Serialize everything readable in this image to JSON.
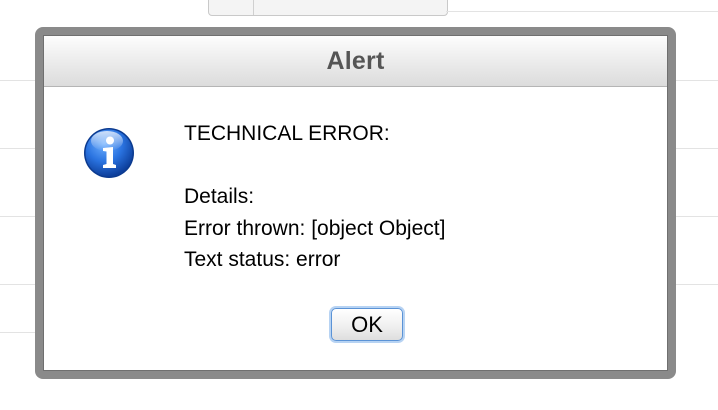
{
  "dialog": {
    "title": "Alert",
    "icon": "info-icon",
    "message_lines": [
      "TECHNICAL ERROR:",
      "",
      "Details:",
      "Error thrown: [object Object]",
      "Text status: error"
    ],
    "ok_label": "OK"
  },
  "colors": {
    "frame": "#8a8a8a",
    "title_text": "#555555",
    "icon_blue": "#1d63d8",
    "button_focus": "#5b93d6"
  }
}
